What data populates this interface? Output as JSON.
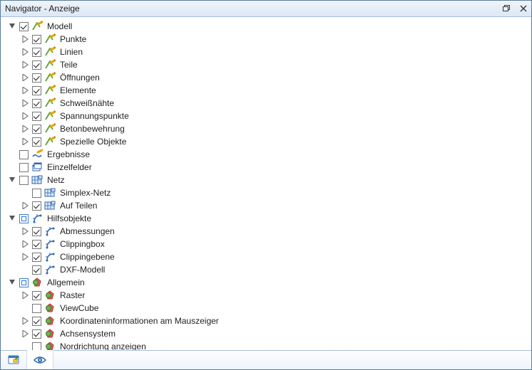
{
  "title": "Navigator - Anzeige",
  "tree": [
    {
      "depth": 0,
      "toggle": "open",
      "check": "checked",
      "iconGroup": "model",
      "label": "Modell"
    },
    {
      "depth": 1,
      "toggle": "closed",
      "check": "checked",
      "iconGroup": "model",
      "label": "Punkte"
    },
    {
      "depth": 1,
      "toggle": "closed",
      "check": "checked",
      "iconGroup": "model",
      "label": "Linien"
    },
    {
      "depth": 1,
      "toggle": "closed",
      "check": "checked",
      "iconGroup": "model",
      "label": "Teile"
    },
    {
      "depth": 1,
      "toggle": "closed",
      "check": "checked",
      "iconGroup": "model",
      "label": "Öffnungen"
    },
    {
      "depth": 1,
      "toggle": "closed",
      "check": "checked",
      "iconGroup": "model",
      "label": "Elemente"
    },
    {
      "depth": 1,
      "toggle": "closed",
      "check": "checked",
      "iconGroup": "model",
      "label": "Schweißnähte"
    },
    {
      "depth": 1,
      "toggle": "closed",
      "check": "checked",
      "iconGroup": "model",
      "label": "Spannungspunkte"
    },
    {
      "depth": 1,
      "toggle": "closed",
      "check": "checked",
      "iconGroup": "model",
      "label": "Betonbewehrung"
    },
    {
      "depth": 1,
      "toggle": "closed",
      "check": "checked",
      "iconGroup": "model",
      "label": "Spezielle Objekte"
    },
    {
      "depth": 0,
      "toggle": "none",
      "check": "unchecked",
      "iconGroup": "results",
      "label": "Ergebnisse"
    },
    {
      "depth": 0,
      "toggle": "none",
      "check": "unchecked",
      "iconGroup": "fields",
      "label": "Einzelfelder"
    },
    {
      "depth": 0,
      "toggle": "open",
      "check": "unchecked",
      "iconGroup": "mesh",
      "label": "Netz"
    },
    {
      "depth": 1,
      "toggle": "none",
      "check": "unchecked",
      "iconGroup": "mesh",
      "label": "Simplex-Netz"
    },
    {
      "depth": 1,
      "toggle": "closed",
      "check": "checked",
      "iconGroup": "mesh",
      "label": "Auf Teilen"
    },
    {
      "depth": 0,
      "toggle": "open",
      "check": "semi",
      "iconGroup": "aux",
      "label": "Hilfsobjekte"
    },
    {
      "depth": 1,
      "toggle": "closed",
      "check": "checked",
      "iconGroup": "aux",
      "label": "Abmessungen"
    },
    {
      "depth": 1,
      "toggle": "closed",
      "check": "checked",
      "iconGroup": "aux",
      "label": "Clippingbox"
    },
    {
      "depth": 1,
      "toggle": "closed",
      "check": "checked",
      "iconGroup": "aux",
      "label": "Clippingebene"
    },
    {
      "depth": 1,
      "toggle": "none",
      "check": "checked",
      "iconGroup": "aux",
      "label": "DXF-Modell"
    },
    {
      "depth": 0,
      "toggle": "open",
      "check": "semi",
      "iconGroup": "general",
      "label": "Allgemein"
    },
    {
      "depth": 1,
      "toggle": "closed",
      "check": "checked",
      "iconGroup": "general",
      "label": "Raster"
    },
    {
      "depth": 1,
      "toggle": "none",
      "check": "unchecked",
      "iconGroup": "general",
      "label": "ViewCube"
    },
    {
      "depth": 1,
      "toggle": "closed",
      "check": "checked",
      "iconGroup": "general",
      "label": "Koordinateninformationen am Mauszeiger"
    },
    {
      "depth": 1,
      "toggle": "closed",
      "check": "checked",
      "iconGroup": "general",
      "label": "Achsensystem"
    },
    {
      "depth": 1,
      "toggle": "none",
      "check": "unchecked",
      "iconGroup": "general",
      "label": "Nordrichtung anzeigen"
    }
  ]
}
